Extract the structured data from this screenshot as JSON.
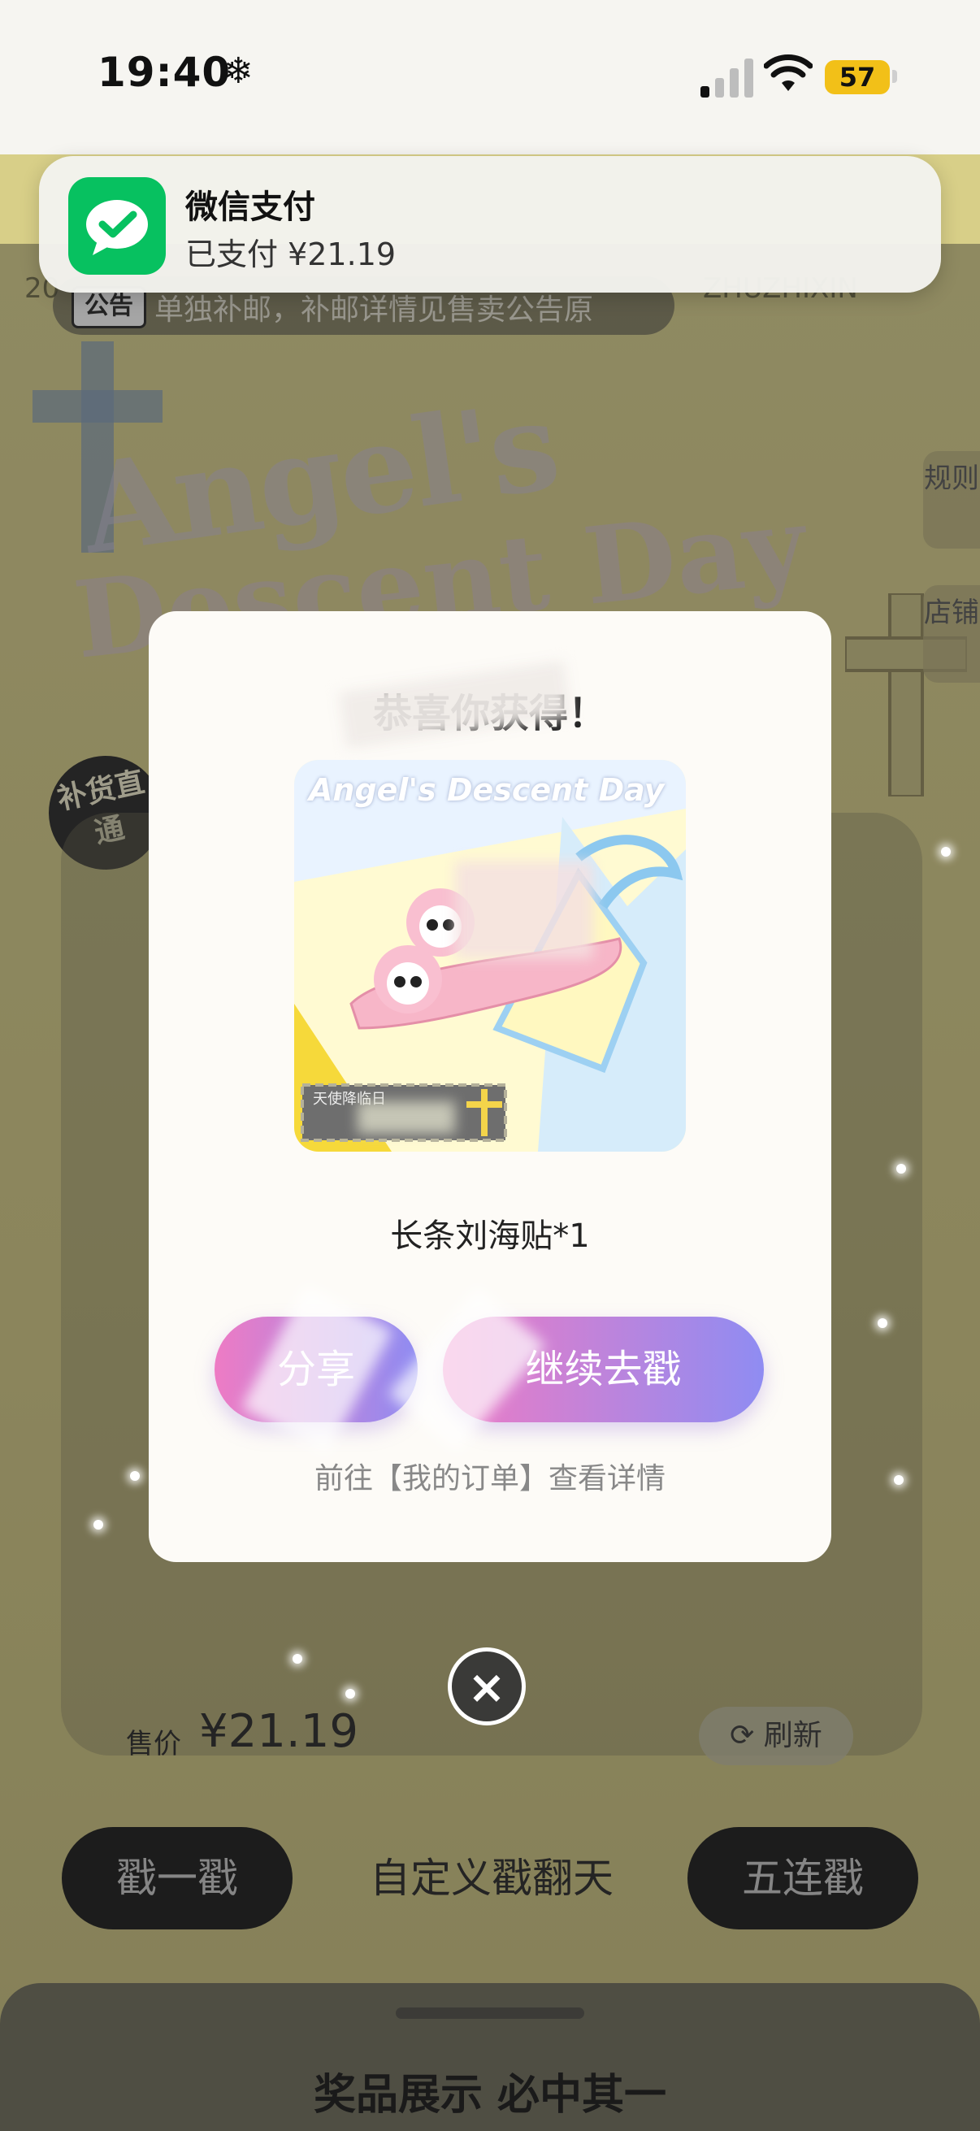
{
  "status_bar": {
    "time": "19:40",
    "snow_glyph": "❄",
    "battery": "57"
  },
  "notification": {
    "title": "微信支付",
    "body": "已支付 ¥21.19"
  },
  "header": {
    "marquee_left": "20",
    "marquee_right": "ZHUZHIXIN"
  },
  "notice": {
    "badge": "公告",
    "text": "单独补邮，补邮详情见售卖公告原"
  },
  "side_buttons": {
    "rules": "规则",
    "shop": "店铺"
  },
  "stamp": {
    "text": "补货直通"
  },
  "decor": {
    "title_line1": "Angel's",
    "title_line2": "Descent Day"
  },
  "modal": {
    "title": "恭喜你获得！",
    "prize_image_label": "Angel's Descent Day",
    "prize_card_caption": "天使降临日",
    "prize_name": "长条刘海贴*1",
    "share_label": "分享",
    "continue_label": "继续去戳",
    "order_link": "前往【我的订单】查看详情",
    "close_glyph": "×"
  },
  "price": {
    "label": "售价",
    "value": "¥21.19"
  },
  "refresh": {
    "label": "刷新",
    "icon": "refresh-icon"
  },
  "actions": {
    "single": "戳一戳",
    "custom": "自定义戳翻天",
    "five": "五连戳"
  },
  "bottom_sheet": {
    "title": "奖品展示 必中其一"
  },
  "colors": {
    "wechat_green": "#07c160",
    "battery_yellow": "#f2c018",
    "button_gradient_start": "#ee7bc4",
    "button_gradient_end": "#8f8cf2"
  }
}
